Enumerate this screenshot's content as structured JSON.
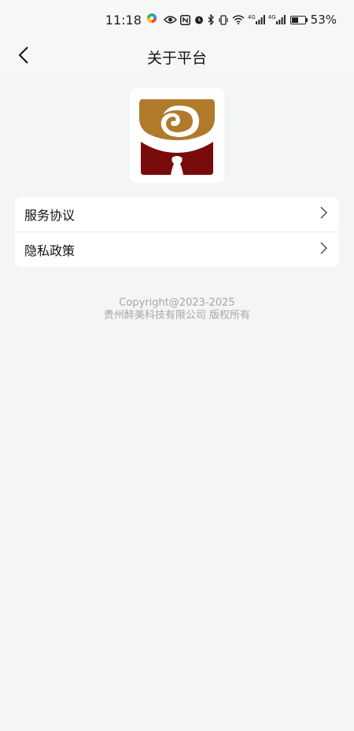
{
  "status_bar": {
    "time": "11:18",
    "battery_percent": "53%",
    "battery_level": 0.53,
    "signal_1_label": "4G",
    "signal_2_label": "4G"
  },
  "nav": {
    "title": "关于平台"
  },
  "menu": {
    "items": [
      {
        "label": "服务协议"
      },
      {
        "label": "隐私政策"
      }
    ]
  },
  "footer": {
    "copyright": "Copyright@2023-2025",
    "company": "贵州醉美科技有限公司 版权所有"
  },
  "colors": {
    "logo_gold": "#b07a2a",
    "logo_red": "#7a0b0b",
    "background": "#f4f5f7"
  }
}
